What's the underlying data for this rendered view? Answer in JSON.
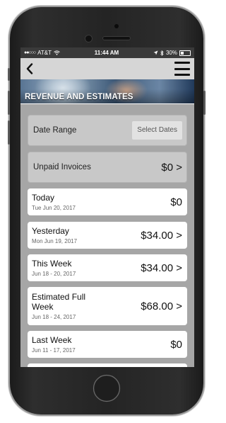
{
  "status": {
    "carrier": "AT&T",
    "time": "11:44 AM",
    "battery": "30%"
  },
  "header": {
    "banner_title": "REVENUE AND ESTIMATES"
  },
  "date_range": {
    "label": "Date Range",
    "button": "Select Dates"
  },
  "unpaid": {
    "label": "Unpaid Invoices",
    "value": "$0 >"
  },
  "rows": [
    {
      "title": "Today",
      "date": "Tue Jun 20, 2017",
      "value": "$0"
    },
    {
      "title": "Yesterday",
      "date": "Mon Jun 19, 2017",
      "value": "$34.00 >"
    },
    {
      "title": "This Week",
      "date": "Jun 18 - 20, 2017",
      "value": "$34.00 >"
    },
    {
      "title": "Estimated Full Week",
      "date": "Jun 18 - 24, 2017",
      "value": "$68.00 >"
    },
    {
      "title": "Last Week",
      "date": "Jun 11 - 17, 2017",
      "value": "$0"
    }
  ],
  "icons": {
    "back": "back-chevron-icon",
    "menu": "hamburger-menu-icon",
    "wifi": "wifi-icon",
    "location": "location-arrow-icon",
    "bluetooth": "bluetooth-icon",
    "battery": "battery-icon"
  }
}
